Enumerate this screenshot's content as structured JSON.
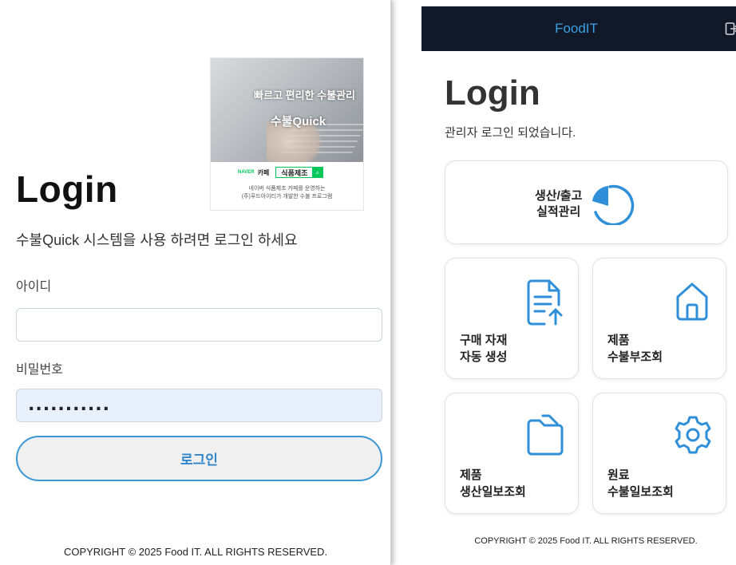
{
  "left": {
    "promo": {
      "tagline": "빠르고 편리한 수불관리",
      "product": "수불Quick",
      "naver": "NAVER",
      "cafe": "카페",
      "search_term": "식품제조",
      "desc_line1": "네이버 식품제조 카페를 운영하는",
      "desc_line2": "(주)푸드아이티가 개발한 수불 프로그램"
    },
    "title": "Login",
    "subtitle": "수불Quick 시스템을 사용 하려면 로그인 하세요",
    "id_label": "아이디",
    "id_value": "",
    "password_label": "비밀번호",
    "password_value": "...........",
    "login_button": "로그인",
    "copyright": "COPYRIGHT © 2025 Food IT. ALL RIGHTS RESERVED."
  },
  "right": {
    "brand": "FoodIT",
    "title": "Login",
    "subtitle": "관리자 로그인 되었습니다.",
    "accent_color": "#2f8fd8",
    "cards": [
      {
        "line1": "생산/출고",
        "line2": "실적관리",
        "icon": "pie-chart-icon"
      },
      {
        "line1": "구매 자재",
        "line2": "자동 생성",
        "icon": "document-upload-icon"
      },
      {
        "line1": "제품",
        "line2": "수불부조회",
        "icon": "home-icon"
      },
      {
        "line1": "제품",
        "line2": "생산일보조회",
        "icon": "folder-icon"
      },
      {
        "line1": "원료",
        "line2": "수불일보조회",
        "icon": "gear-icon"
      }
    ],
    "copyright": "COPYRIGHT © 2025 Food IT. ALL RIGHTS RESERVED."
  }
}
